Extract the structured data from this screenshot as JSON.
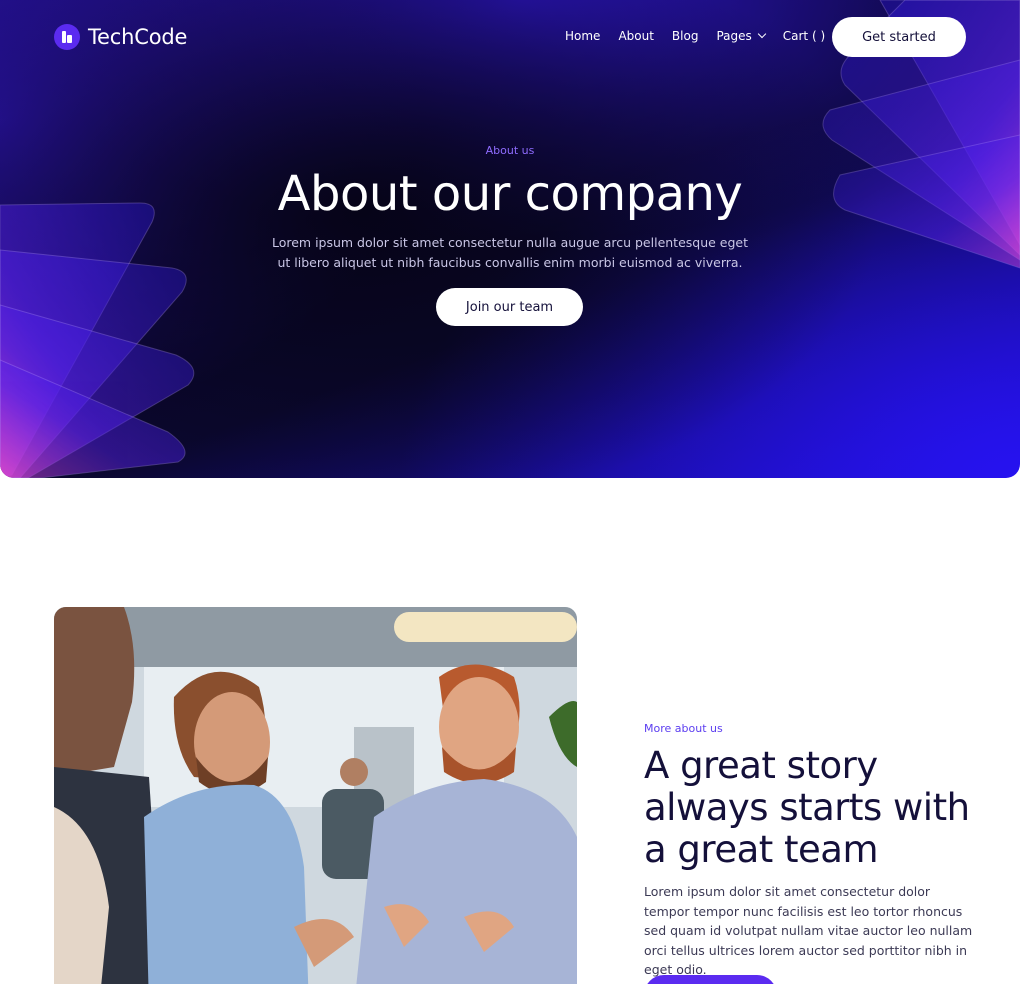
{
  "brand": {
    "name": "TechCode",
    "accent": "#5b2bf0"
  },
  "nav": {
    "items": [
      {
        "label": "Home"
      },
      {
        "label": "About"
      },
      {
        "label": "Blog"
      },
      {
        "label": "Pages",
        "icon": "chevron-down-icon"
      },
      {
        "label": "Cart ( )"
      }
    ],
    "cta_label": "Get started"
  },
  "hero": {
    "eyebrow": "About us",
    "title": "About our company",
    "text": "Lorem ipsum dolor sit amet consectetur nulla augue arcu pellentesque eget ut libero aliquet ut nibh faucibus convallis enim morbi euismod ac viverra.",
    "cta_label": "Join our team"
  },
  "about": {
    "eyebrow": "More about us",
    "title": "A great story always starts with a great team",
    "text": "Lorem ipsum dolor sit amet consectetur dolor tempor tempor nunc facilisis est leo tortor rhoncus sed quam id volutpat nullam vitae auctor leo nullam orci tellus ultrices lorem auctor sed porttitor nibh in eget odio."
  },
  "colors": {
    "hero_dark": "#0a0630",
    "hero_blue": "#2612f0",
    "eyebrow": "#8f6cff",
    "title_dark": "#14103a"
  }
}
